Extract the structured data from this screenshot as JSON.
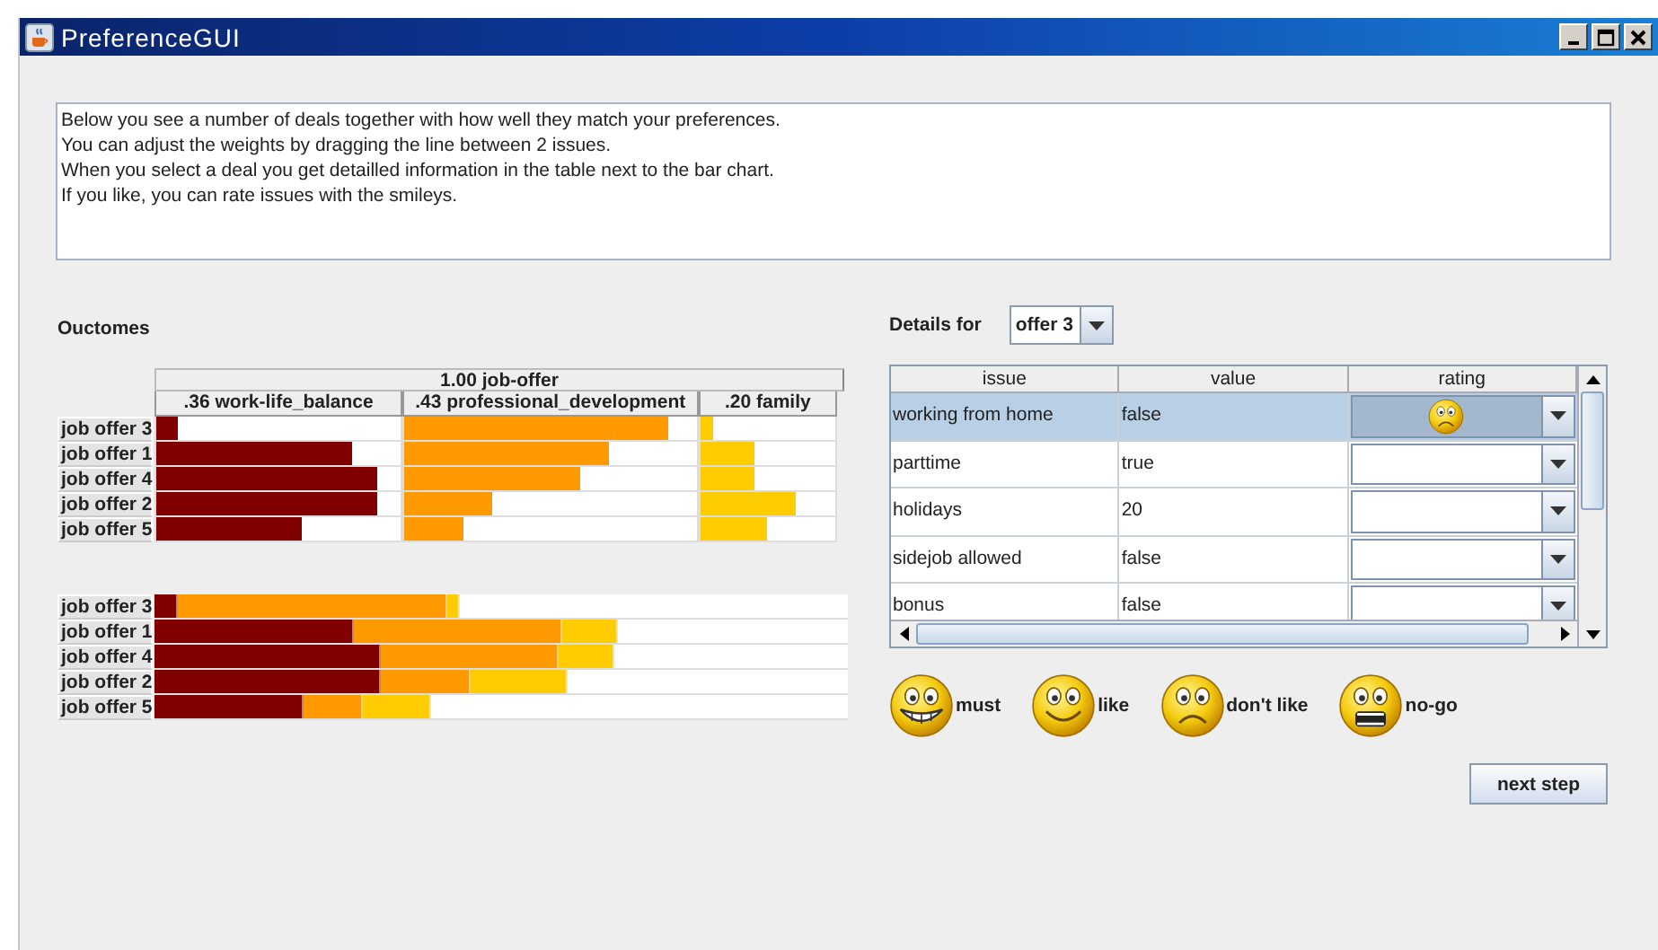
{
  "window": {
    "title": "PreferenceGUI"
  },
  "instructions": [
    "Below you see a number of deals together with how well they match your preferences.",
    "You can adjust the weights by dragging the line between 2 issues.",
    "When you select a deal you get detailled information in the table next to the bar chart.",
    "If you like, you can rate issues with the smileys."
  ],
  "outcomes": {
    "title": "Ouctomes",
    "root": "1.00  job-offer",
    "issues": [
      {
        "label": ".36  work-life_balance",
        "color": "#800000"
      },
      {
        "label": ".43  professional_development",
        "color": "#ff9900"
      },
      {
        "label": ".20  family",
        "color": "#ffcc00"
      }
    ],
    "offers": [
      {
        "label": "job offer 3",
        "scores": [
          {
            "level": 0.09
          },
          {
            "level": 0.905
          },
          {
            "level": 0.1
          }
        ]
      },
      {
        "label": "job offer 1",
        "scores": [
          {
            "level": 0.8
          },
          {
            "level": 0.7
          },
          {
            "level": 0.4
          }
        ]
      },
      {
        "label": "job offer 4",
        "scores": [
          {
            "level": 0.905
          },
          {
            "level": 0.6
          },
          {
            "level": 0.4
          }
        ]
      },
      {
        "label": "job offer 2",
        "scores": [
          {
            "level": 0.905
          },
          {
            "level": 0.3
          },
          {
            "level": 0.7
          }
        ]
      },
      {
        "label": "job offer 5",
        "scores": [
          {
            "level": 0.595
          },
          {
            "level": 0.2
          },
          {
            "level": 0.5
          }
        ]
      }
    ],
    "totals": [
      {
        "label": "job offer 3"
      },
      {
        "label": "job offer 1"
      },
      {
        "label": "job offer 4"
      },
      {
        "label": "job offer 2"
      },
      {
        "label": "job offer 5"
      }
    ]
  },
  "details": {
    "label": "Details for",
    "offer": "offer 3",
    "columns": [
      "issue",
      "value",
      "rating"
    ],
    "rows": [
      {
        "issue": "working from home",
        "value": "false",
        "selected": true,
        "rating": {
          "kind": "dont_like"
        }
      },
      {
        "issue": "parttime",
        "value": "true",
        "selected": false
      },
      {
        "issue": "holidays",
        "value": "20",
        "selected": false
      },
      {
        "issue": "sidejob allowed",
        "value": "false",
        "selected": false
      },
      {
        "issue": "bonus",
        "value": "false",
        "selected": false
      }
    ]
  },
  "legend": [
    {
      "kind": "must",
      "label": "must"
    },
    {
      "kind": "like",
      "label": "like"
    },
    {
      "kind": "dont_like",
      "label": "don't like"
    },
    {
      "kind": "no_go",
      "label": "no-go"
    }
  ],
  "buttons": [
    "next step"
  ]
}
